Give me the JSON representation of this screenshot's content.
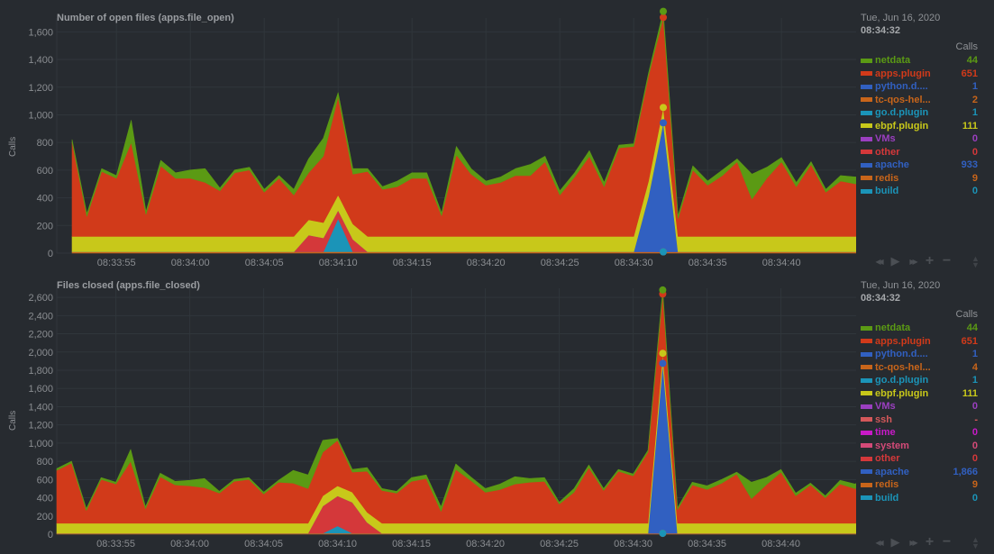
{
  "charts": [
    {
      "id": "file_open",
      "title": "Number of open files (apps.file_open)",
      "ylabel": "Calls",
      "legend": {
        "date": "Tue, Jun 16, 2020",
        "time": "08:34:32",
        "units": "Calls",
        "items": [
          {
            "name": "netdata",
            "value": "44",
            "color": "#5b9a14"
          },
          {
            "name": "apps.plugin",
            "value": "651",
            "color": "#d13a1a"
          },
          {
            "name": "python.d....",
            "value": "1",
            "color": "#3160c1"
          },
          {
            "name": "tc-qos-hel...",
            "value": "2",
            "color": "#c8651a"
          },
          {
            "name": "go.d.plugin",
            "value": "1",
            "color": "#1b94b8"
          },
          {
            "name": "ebpf.plugin",
            "value": "111",
            "color": "#c8c81a"
          },
          {
            "name": "VMs",
            "value": "0",
            "color": "#9b3fc0"
          },
          {
            "name": "other",
            "value": "0",
            "color": "#d4383a"
          },
          {
            "name": "apache",
            "value": "933",
            "color": "#3160c1"
          },
          {
            "name": "redis",
            "value": "9",
            "color": "#c8651a"
          },
          {
            "name": "build",
            "value": "0",
            "color": "#1b94b8"
          }
        ]
      },
      "toolbar": {
        "rewind": "◀◀",
        "play": "▶",
        "forward": "▶▶",
        "zoom_in": "+",
        "zoom_out": "−"
      }
    },
    {
      "id": "file_closed",
      "title": "Files closed (apps.file_closed)",
      "ylabel": "Calls",
      "legend": {
        "date": "Tue, Jun 16, 2020",
        "time": "08:34:32",
        "units": "Calls",
        "items": [
          {
            "name": "netdata",
            "value": "44",
            "color": "#5b9a14"
          },
          {
            "name": "apps.plugin",
            "value": "651",
            "color": "#d13a1a"
          },
          {
            "name": "python.d....",
            "value": "1",
            "color": "#3160c1"
          },
          {
            "name": "tc-qos-hel...",
            "value": "4",
            "color": "#c8651a"
          },
          {
            "name": "go.d.plugin",
            "value": "1",
            "color": "#1b94b8"
          },
          {
            "name": "ebpf.plugin",
            "value": "111",
            "color": "#c8c81a"
          },
          {
            "name": "VMs",
            "value": "0",
            "color": "#9b3fc0"
          },
          {
            "name": "ssh",
            "value": "-",
            "color": "#d4585a"
          },
          {
            "name": "time",
            "value": "0",
            "color": "#c81ac8"
          },
          {
            "name": "system",
            "value": "0",
            "color": "#d44a78"
          },
          {
            "name": "other",
            "value": "0",
            "color": "#d4383a"
          },
          {
            "name": "apache",
            "value": "1,866",
            "color": "#3160c1"
          },
          {
            "name": "redis",
            "value": "9",
            "color": "#c8651a"
          },
          {
            "name": "build",
            "value": "0",
            "color": "#1b94b8"
          }
        ]
      },
      "toolbar": {
        "rewind": "◀◀",
        "play": "▶",
        "forward": "▶▶",
        "zoom_in": "+",
        "zoom_out": "−"
      }
    }
  ],
  "chart_data": [
    {
      "type": "area",
      "stacked": true,
      "title": "Number of open files (apps.file_open)",
      "xlabel": "",
      "ylabel": "Calls",
      "ylim": [
        0,
        1700
      ],
      "yticks": [
        "0",
        "200",
        "400",
        "600",
        "800",
        "1,000",
        "1,200",
        "1,400",
        "1,600"
      ],
      "ytick_values": [
        0,
        200,
        400,
        600,
        800,
        1000,
        1200,
        1400,
        1600
      ],
      "xticks": [
        "08:33:55",
        "08:34:00",
        "08:34:05",
        "08:34:10",
        "08:34:15",
        "08:34:20",
        "08:34:25",
        "08:34:30",
        "08:34:35",
        "08:34:40"
      ],
      "xtick_seconds": [
        3,
        8,
        13,
        18,
        23,
        28,
        33,
        38,
        43,
        48
      ],
      "x_start": "08:33:52",
      "x_step_seconds": 1,
      "grid": true,
      "highlight_index": 40,
      "series": [
        {
          "name": "redis",
          "color": "#c8651a",
          "values": [
            10,
            10,
            10,
            10,
            10,
            10,
            10,
            10,
            10,
            10,
            10,
            10,
            10,
            10,
            10,
            10,
            10,
            10,
            10,
            10,
            10,
            10,
            10,
            10,
            10,
            10,
            10,
            10,
            10,
            10,
            10,
            10,
            10,
            10,
            10,
            10,
            10,
            10,
            10,
            10,
            9,
            10,
            10,
            10,
            10,
            10,
            10,
            10,
            10,
            10,
            10,
            10,
            10,
            10,
            10
          ]
        },
        {
          "name": "build",
          "color": "#1b94b8",
          "values": [
            0,
            0,
            0,
            0,
            0,
            0,
            0,
            0,
            0,
            0,
            0,
            0,
            0,
            0,
            0,
            0,
            0,
            0,
            240,
            0,
            0,
            0,
            0,
            0,
            0,
            0,
            0,
            0,
            0,
            0,
            0,
            0,
            0,
            0,
            0,
            0,
            0,
            0,
            0,
            0,
            0,
            0,
            0,
            0,
            0,
            0,
            0,
            0,
            0,
            0,
            0,
            0,
            0,
            0,
            0
          ]
        },
        {
          "name": "other",
          "color": "#d4383a",
          "values": [
            0,
            0,
            0,
            0,
            0,
            0,
            0,
            0,
            0,
            0,
            0,
            0,
            0,
            0,
            0,
            0,
            120,
            100,
            60,
            90,
            0,
            0,
            0,
            0,
            0,
            0,
            0,
            0,
            0,
            0,
            0,
            0,
            0,
            0,
            0,
            0,
            0,
            0,
            0,
            0,
            0,
            0,
            0,
            0,
            0,
            0,
            0,
            0,
            0,
            0,
            0,
            0,
            0,
            0,
            0
          ]
        },
        {
          "name": "apache",
          "color": "#3160c1",
          "values": [
            0,
            0,
            0,
            0,
            0,
            0,
            0,
            0,
            0,
            0,
            0,
            0,
            0,
            0,
            0,
            0,
            0,
            0,
            0,
            0,
            0,
            0,
            0,
            0,
            0,
            0,
            0,
            0,
            0,
            0,
            0,
            0,
            0,
            0,
            0,
            0,
            0,
            0,
            0,
            400,
            933,
            0,
            0,
            0,
            0,
            0,
            0,
            0,
            0,
            0,
            0,
            0,
            0,
            0,
            0
          ]
        },
        {
          "name": "ebpf.plugin",
          "color": "#c8c81a",
          "values": [
            111,
            111,
            111,
            111,
            111,
            111,
            111,
            111,
            111,
            111,
            111,
            111,
            111,
            111,
            111,
            111,
            111,
            111,
            111,
            111,
            111,
            111,
            111,
            111,
            111,
            111,
            111,
            111,
            111,
            111,
            111,
            111,
            111,
            111,
            111,
            111,
            111,
            111,
            111,
            111,
            111,
            111,
            111,
            111,
            111,
            111,
            111,
            111,
            111,
            111,
            111,
            111,
            111,
            111,
            111
          ]
        },
        {
          "name": "apps.plugin",
          "color": "#d13a1a",
          "values": [
            680,
            145,
            470,
            420,
            680,
            160,
            510,
            420,
            420,
            390,
            330,
            460,
            480,
            320,
            420,
            300,
            340,
            480,
            710,
            360,
            470,
            340,
            360,
            420,
            420,
            150,
            590,
            450,
            370,
            390,
            440,
            440,
            540,
            300,
            430,
            580,
            360,
            640,
            650,
            760,
            651,
            130,
            480,
            370,
            440,
            540,
            270,
            420,
            540,
            360,
            520,
            320,
            400,
            380,
            370
          ]
        },
        {
          "name": "netdata",
          "color": "#5b9a14",
          "values": [
            20,
            20,
            20,
            20,
            160,
            20,
            40,
            40,
            60,
            100,
            20,
            20,
            20,
            20,
            20,
            40,
            100,
            130,
            30,
            40,
            20,
            20,
            40,
            40,
            40,
            20,
            60,
            40,
            30,
            40,
            50,
            80,
            40,
            30,
            30,
            40,
            30,
            20,
            20,
            20,
            44,
            20,
            30,
            30,
            40,
            20,
            180,
            80,
            30,
            30,
            20,
            20,
            40,
            50,
            80
          ]
        }
      ]
    },
    {
      "type": "area",
      "stacked": true,
      "title": "Files closed (apps.file_closed)",
      "xlabel": "",
      "ylabel": "Calls",
      "ylim": [
        0,
        2700
      ],
      "yticks": [
        "0",
        "200",
        "400",
        "600",
        "800",
        "1,000",
        "1,200",
        "1,400",
        "1,600",
        "1,800",
        "2,000",
        "2,200",
        "2,400",
        "2,600"
      ],
      "ytick_values": [
        0,
        200,
        400,
        600,
        800,
        1000,
        1200,
        1400,
        1600,
        1800,
        2000,
        2200,
        2400,
        2600
      ],
      "xticks": [
        "08:33:55",
        "08:34:00",
        "08:34:05",
        "08:34:10",
        "08:34:15",
        "08:34:20",
        "08:34:25",
        "08:34:30",
        "08:34:35",
        "08:34:40"
      ],
      "xtick_seconds": [
        4,
        9,
        14,
        19,
        24,
        29,
        34,
        39,
        44,
        49
      ],
      "x_start": "08:33:51",
      "x_step_seconds": 1,
      "grid": true,
      "highlight_index": 41,
      "series": [
        {
          "name": "redis",
          "color": "#c8651a",
          "values": [
            10,
            10,
            10,
            10,
            10,
            10,
            10,
            10,
            10,
            10,
            10,
            10,
            10,
            10,
            10,
            10,
            10,
            10,
            10,
            10,
            10,
            10,
            10,
            10,
            10,
            10,
            10,
            10,
            10,
            10,
            10,
            10,
            10,
            10,
            10,
            10,
            10,
            10,
            10,
            10,
            10,
            9,
            10,
            10,
            10,
            10,
            10,
            10,
            10,
            10,
            10,
            10,
            10,
            10,
            10,
            10
          ]
        },
        {
          "name": "build",
          "color": "#1b94b8",
          "values": [
            0,
            0,
            0,
            0,
            0,
            0,
            0,
            0,
            0,
            0,
            0,
            0,
            0,
            0,
            0,
            0,
            0,
            0,
            0,
            80,
            0,
            0,
            0,
            0,
            0,
            0,
            0,
            0,
            0,
            0,
            0,
            0,
            0,
            0,
            0,
            0,
            0,
            0,
            0,
            0,
            0,
            0,
            0,
            0,
            0,
            0,
            0,
            0,
            0,
            0,
            0,
            0,
            0,
            0,
            0,
            0
          ]
        },
        {
          "name": "other",
          "color": "#d4383a",
          "values": [
            0,
            0,
            0,
            0,
            0,
            0,
            0,
            0,
            0,
            0,
            0,
            0,
            0,
            0,
            0,
            0,
            0,
            0,
            300,
            330,
            340,
            120,
            0,
            0,
            0,
            0,
            0,
            0,
            0,
            0,
            0,
            0,
            0,
            0,
            0,
            0,
            0,
            0,
            0,
            0,
            0,
            0,
            0,
            0,
            0,
            0,
            0,
            0,
            0,
            0,
            0,
            0,
            0,
            0,
            0,
            0
          ]
        },
        {
          "name": "apache",
          "color": "#3160c1",
          "values": [
            0,
            0,
            0,
            0,
            0,
            0,
            0,
            0,
            0,
            0,
            0,
            0,
            0,
            0,
            0,
            0,
            0,
            0,
            0,
            0,
            0,
            0,
            0,
            0,
            0,
            0,
            0,
            0,
            0,
            0,
            0,
            0,
            0,
            0,
            0,
            0,
            0,
            0,
            0,
            0,
            0,
            1866,
            0,
            0,
            0,
            0,
            0,
            0,
            0,
            0,
            0,
            0,
            0,
            0,
            0,
            0
          ]
        },
        {
          "name": "ebpf.plugin",
          "color": "#c8c81a",
          "values": [
            111,
            111,
            111,
            111,
            111,
            111,
            111,
            111,
            111,
            111,
            111,
            111,
            111,
            111,
            111,
            111,
            111,
            111,
            111,
            111,
            111,
            111,
            111,
            111,
            111,
            111,
            111,
            111,
            111,
            111,
            111,
            111,
            111,
            111,
            111,
            111,
            111,
            111,
            111,
            111,
            111,
            111,
            111,
            111,
            111,
            111,
            111,
            111,
            111,
            111,
            111,
            111,
            111,
            111,
            111,
            111
          ]
        },
        {
          "name": "apps.plugin",
          "color": "#d13a1a",
          "values": [
            580,
            660,
            140,
            480,
            430,
            680,
            160,
            510,
            420,
            410,
            390,
            330,
            460,
            480,
            320,
            450,
            440,
            380,
            480,
            500,
            220,
            450,
            360,
            330,
            460,
            490,
            130,
            590,
            470,
            340,
            370,
            430,
            450,
            460,
            210,
            340,
            610,
            360,
            570,
            520,
            780,
            651,
            150,
            420,
            370,
            440,
            540,
            270,
            420,
            560,
            300,
            420,
            280,
            430,
            380,
            420
          ]
        },
        {
          "name": "netdata",
          "color": "#5b9a14",
          "values": [
            20,
            20,
            20,
            20,
            20,
            130,
            20,
            40,
            40,
            60,
            100,
            20,
            20,
            20,
            20,
            20,
            140,
            150,
            130,
            20,
            30,
            40,
            20,
            20,
            40,
            40,
            50,
            60,
            40,
            40,
            60,
            80,
            40,
            40,
            20,
            40,
            30,
            20,
            20,
            20,
            20,
            44,
            20,
            30,
            40,
            40,
            20,
            180,
            80,
            30,
            30,
            20,
            20,
            40,
            50,
            80
          ]
        }
      ]
    }
  ]
}
